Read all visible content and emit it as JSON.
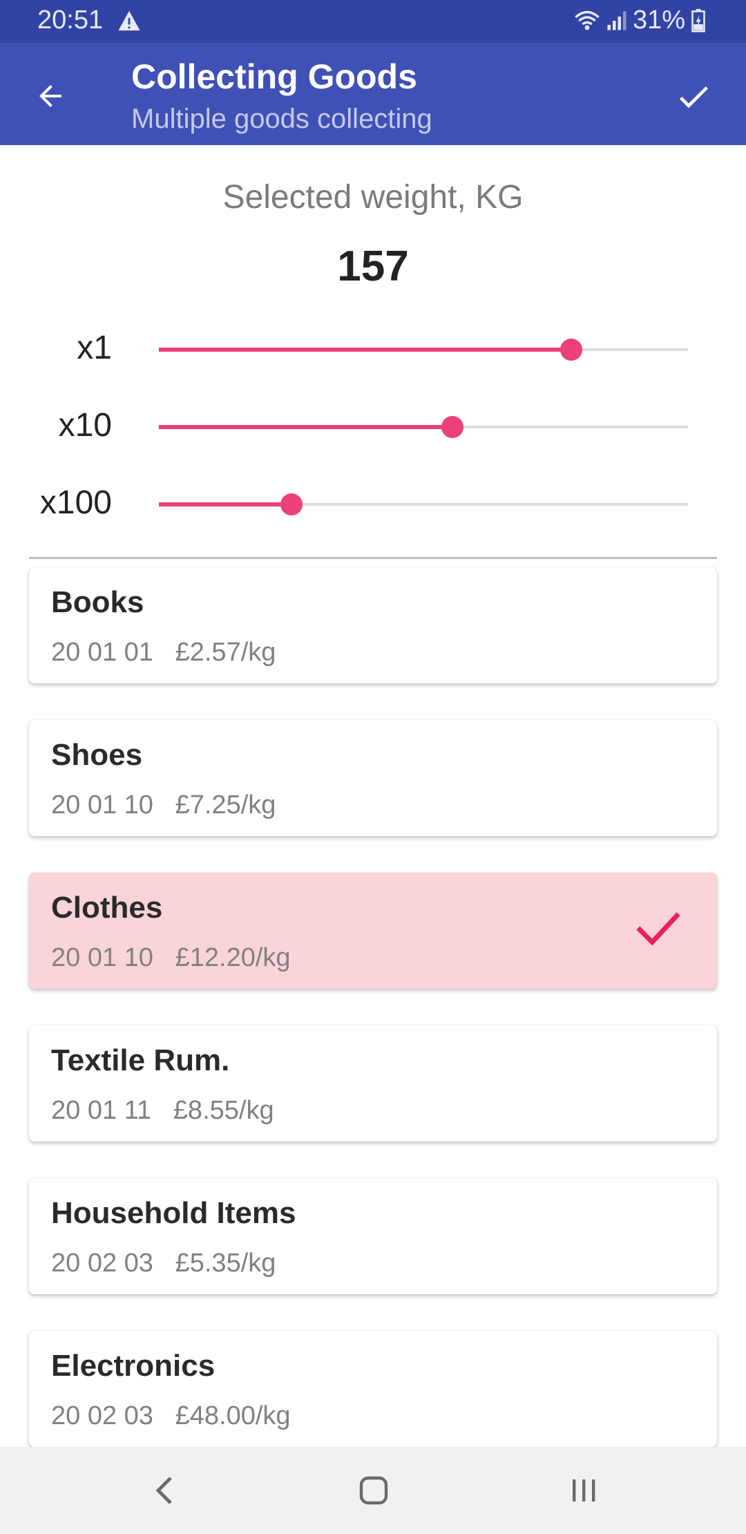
{
  "status_bar": {
    "time": "20:51",
    "battery": "31%"
  },
  "app_bar": {
    "title": "Collecting Goods",
    "subtitle": "Multiple goods collecting",
    "back_icon": "arrow-back-icon",
    "confirm_icon": "check-icon"
  },
  "weight": {
    "label": "Selected weight, KG",
    "value": "157"
  },
  "sliders": [
    {
      "label": "x1",
      "value_fraction": 0.78
    },
    {
      "label": "x10",
      "value_fraction": 0.555
    },
    {
      "label": "x100",
      "value_fraction": 0.25
    }
  ],
  "goods": [
    {
      "name": "Books",
      "code": "20 01 01",
      "price": "£2.57/kg",
      "selected": false
    },
    {
      "name": "Shoes",
      "code": "20 01 10",
      "price": "£7.25/kg",
      "selected": false
    },
    {
      "name": "Clothes",
      "code": "20 01 10",
      "price": "£12.20/kg",
      "selected": true
    },
    {
      "name": "Textile Rum.",
      "code": "20 01 11",
      "price": "£8.55/kg",
      "selected": false
    },
    {
      "name": "Household Items",
      "code": "20 02 03",
      "price": "£5.35/kg",
      "selected": false
    },
    {
      "name": "Electronics",
      "code": "20 02 03",
      "price": "£48.00/kg",
      "selected": false
    }
  ],
  "colors": {
    "primary": "#3f51b5",
    "status_bar": "#3243a6",
    "accent": "#ec407a",
    "selected_card": "#fbd4d8"
  },
  "nav_bar": {
    "back_icon": "nav-back-icon",
    "home_icon": "nav-home-icon",
    "recents_icon": "nav-recents-icon"
  }
}
